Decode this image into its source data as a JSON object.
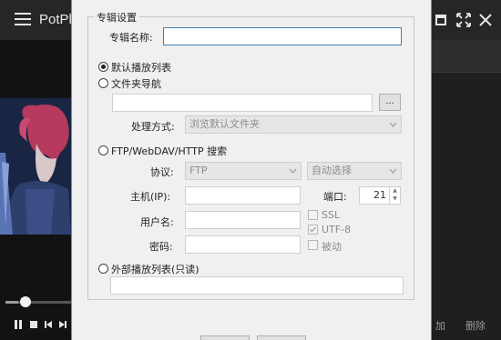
{
  "player": {
    "app_title": "PotPl",
    "playlist_buttons": [
      "加",
      "删除"
    ],
    "seek_progress": 0.2
  },
  "dialog": {
    "group_title": "专辑设置",
    "album_name_label": "专辑名称:",
    "album_name_value": "",
    "option_default_playlist": "默认播放列表",
    "option_folder_nav": "文件夹导航",
    "folder_path_value": "",
    "browse_label": "...",
    "handling_label": "处理方式:",
    "handling_value": "浏览默认文件夹",
    "option_ftp": "FTP/WebDAV/HTTP 搜索",
    "protocol_label": "协议:",
    "protocol_value": "FTP",
    "encoding_value": "自动选择",
    "host_label": "主机(IP):",
    "port_label": "端口:",
    "port_value": "21",
    "username_label": "用户名:",
    "password_label": "密码:",
    "ssl_label": "SSL",
    "utf8_label": "UTF-8",
    "passive_label": "被动",
    "option_external_playlist": "外部播放列表(只读)",
    "selected_option": "默认播放列表"
  }
}
